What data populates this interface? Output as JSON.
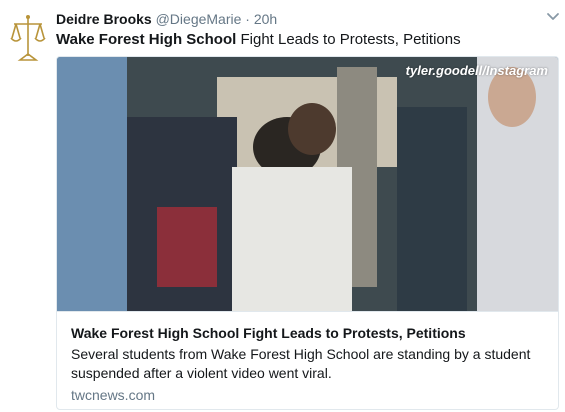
{
  "tweet": {
    "author_name": "Deidre Brooks",
    "handle": "@DiegeMarie",
    "separator": "·",
    "time": "20h",
    "text_bold": "Wake Forest High School",
    "text_rest": " Fight Leads to Protests, Petitions"
  },
  "icons": {
    "avatar": "scales-of-justice-icon",
    "caret": "chevron-down-icon"
  },
  "card": {
    "watermark": "tyler.goodell/Instagram",
    "title": "Wake Forest High School Fight Leads to Protests, Petitions",
    "description": "Several students from Wake Forest High School are standing by a student suspended after a violent video went viral.",
    "domain": "twcnews.com"
  },
  "colors": {
    "text": "#14171a",
    "secondary": "#657786",
    "border": "#e1e8ed"
  }
}
